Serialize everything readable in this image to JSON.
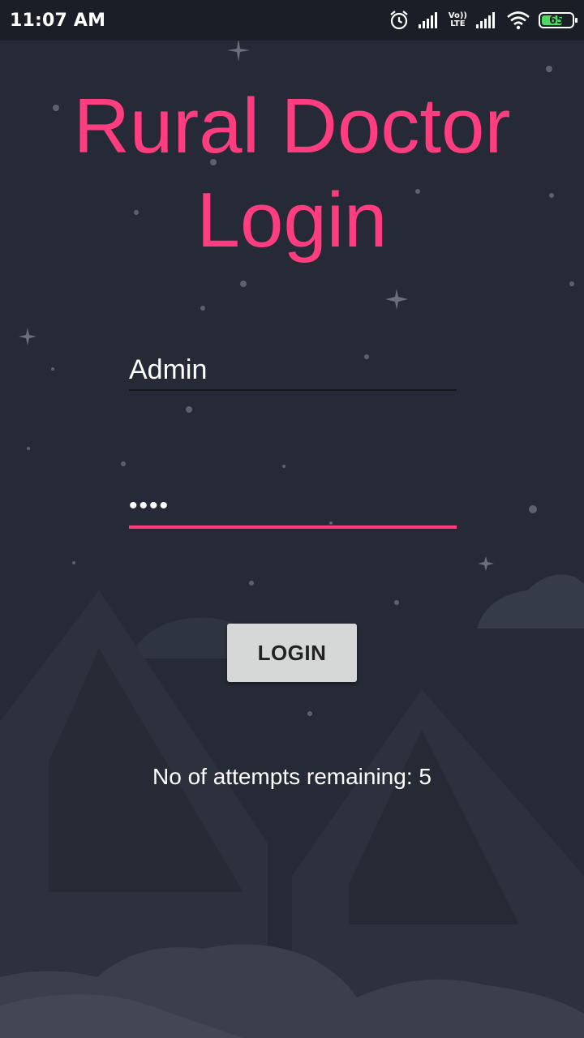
{
  "status_bar": {
    "time": "11:07 AM",
    "network_label_top": "Vo))",
    "network_label_bottom": "LTE",
    "battery_percent": "65",
    "icons": [
      "alarm-icon",
      "signal-icon",
      "volte-icon",
      "signal-icon",
      "wifi-icon",
      "battery-icon"
    ]
  },
  "login": {
    "title": "Rural Doctor Login",
    "username_value": "Admin",
    "password_value": "••••",
    "login_button": "LOGIN",
    "attempts_text": "No of attempts remaining: 5"
  },
  "colors": {
    "accent": "#ff3d7f",
    "background": "#262a36",
    "status_bar": "#1b1e26",
    "button": "#d6d7d7",
    "battery": "#4cd964"
  }
}
